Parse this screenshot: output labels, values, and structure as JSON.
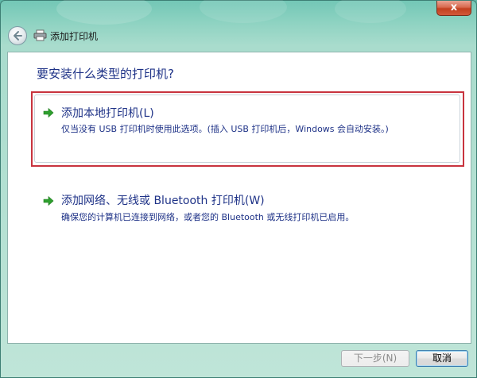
{
  "window": {
    "title": "添加打印机",
    "close_label": "x"
  },
  "main": {
    "heading": "要安装什么类型的打印机?",
    "options": [
      {
        "title": "添加本地打印机(L)",
        "description": "仅当没有 USB 打印机时使用此选项。(插入 USB 打印机后，Windows 会自动安装。)"
      },
      {
        "title": "添加网络、无线或 Bluetooth 打印机(W)",
        "description": "确保您的计算机已连接到网络，或者您的 Bluetooth 或无线打印机已启用。"
      }
    ]
  },
  "footer": {
    "next_label": "下一步(N)",
    "cancel_label": "取消"
  },
  "colors": {
    "frame": "#8fd3c2",
    "text_blue": "#1e3287",
    "highlight_red": "#c8333e",
    "arrow_green": "#2e9f2e"
  }
}
